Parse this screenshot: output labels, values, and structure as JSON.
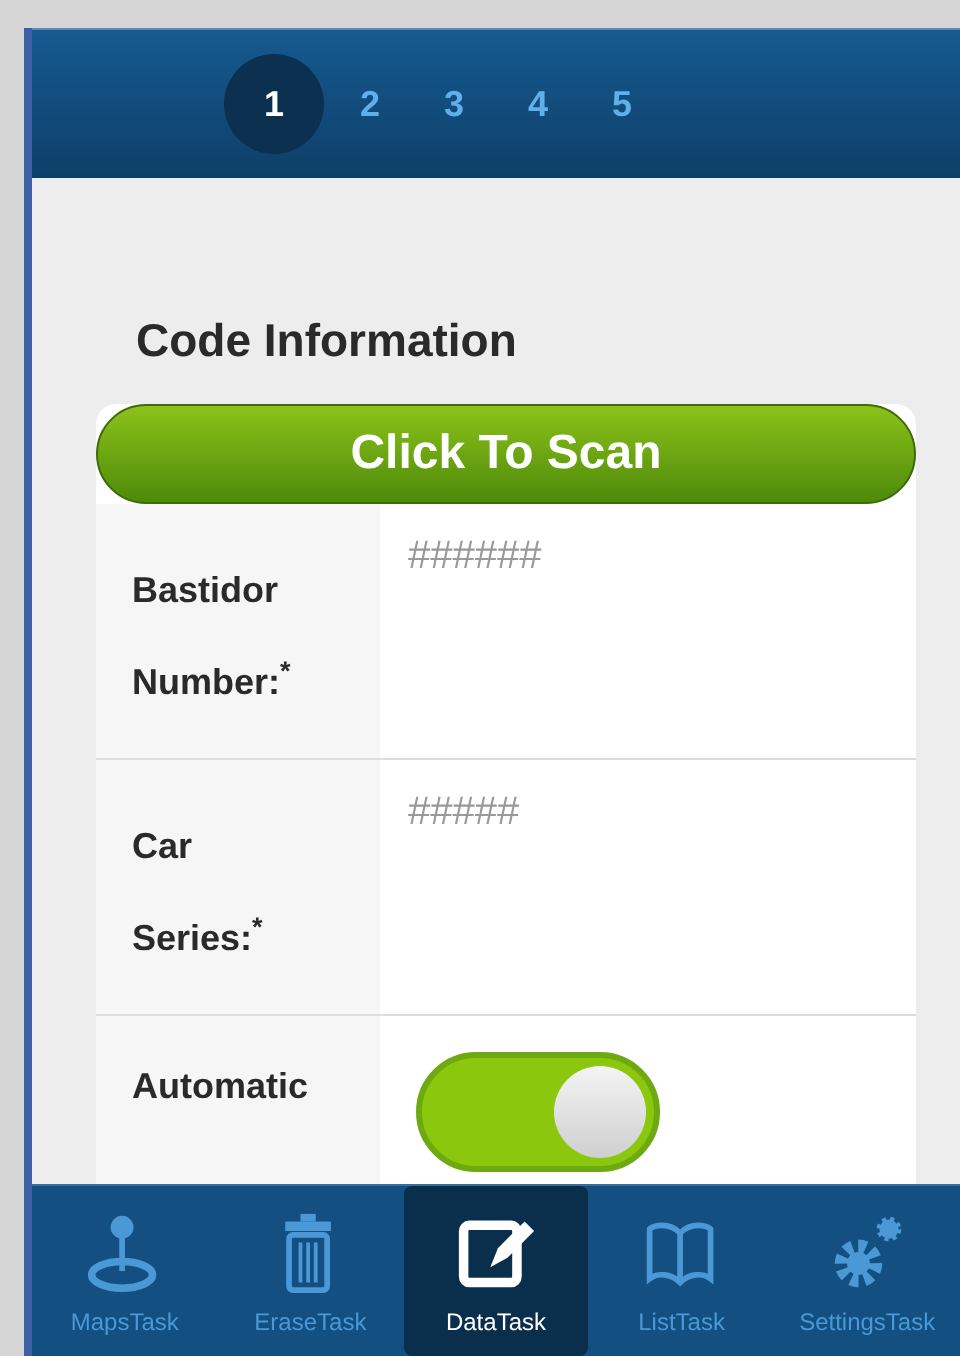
{
  "pager": [
    {
      "label": "1",
      "selected": true
    },
    {
      "label": "2",
      "selected": false
    },
    {
      "label": "3",
      "selected": false
    },
    {
      "label": "4",
      "selected": false
    },
    {
      "label": "5",
      "selected": false
    }
  ],
  "section_title": "Code Information",
  "scan_button": "Click To Scan",
  "fields": [
    {
      "kind": "text",
      "label": "Bastidor Number:$^{*}$",
      "placeholder": "######"
    },
    {
      "kind": "text",
      "label": "Car Series:$^{*}$",
      "placeholder": "#####"
    },
    {
      "kind": "toggle",
      "label": "Automatic",
      "on": true
    }
  ],
  "tabs": [
    {
      "kind": "pin",
      "label": "MapsTask",
      "selected": false
    },
    {
      "kind": "trash",
      "label": "EraseTask",
      "selected": false
    },
    {
      "kind": "edit",
      "label": "DataTask",
      "selected": true
    },
    {
      "kind": "book",
      "label": "ListTask",
      "selected": false
    },
    {
      "kind": "gears",
      "label": "SettingsTask",
      "selected": false
    }
  ]
}
